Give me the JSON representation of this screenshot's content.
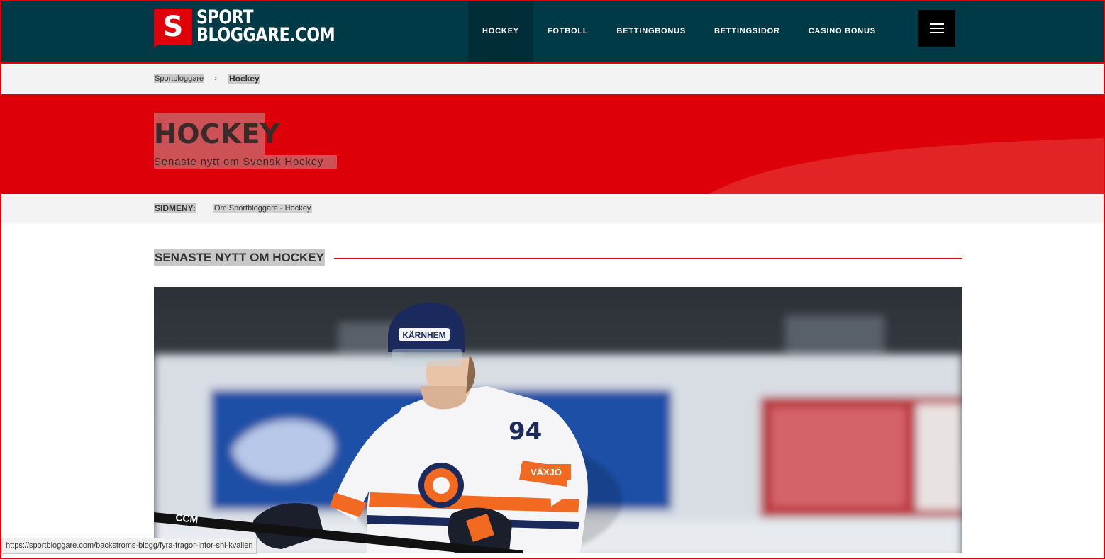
{
  "header": {
    "logo": {
      "badge_letter": "S",
      "line1": "SPORT",
      "line2": "BLOGGARE.COM"
    },
    "nav": [
      {
        "label": "HOCKEY",
        "active": true
      },
      {
        "label": "FOTBOLL",
        "active": false
      },
      {
        "label": "BETTINGBONUS",
        "active": false
      },
      {
        "label": "BETTINGSIDOR",
        "active": false
      },
      {
        "label": "CASINO BONUS",
        "active": false
      }
    ],
    "menu_icon": "hamburger-icon"
  },
  "breadcrumb": {
    "home": "Sportbloggare",
    "separator": "›",
    "current": "Hockey"
  },
  "hero": {
    "title": "HOCKEY",
    "subtitle": "Senaste nytt om Svensk Hockey"
  },
  "sidemenu": {
    "label": "SIDMENY:",
    "links": [
      "Om Sportbloggare - Hockey"
    ]
  },
  "section": {
    "title": "SENASTE NYTT OM HOCKEY"
  },
  "article_image": {
    "jersey_number": "94",
    "helmet_text": "KÄRNHEM",
    "sponsor_right": "VÄXJÖ",
    "stick_brand": "CCM"
  },
  "statusbar": {
    "url": "https://sportbloggare.com/backstroms-blogg/fyra-fragor-infor-shl-kvallen"
  },
  "colors": {
    "header_bg": "#013a47",
    "accent_red": "#dd0009",
    "breadcrumb_bg": "#f3f3f3"
  }
}
